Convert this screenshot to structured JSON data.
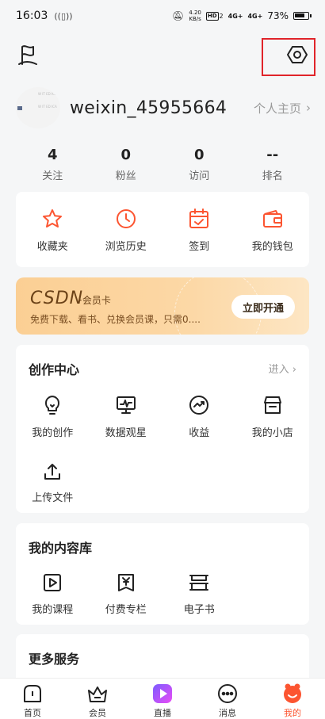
{
  "status": {
    "time": "16:03",
    "net_speed_top": "4.20",
    "net_speed_bottom": "KB/s",
    "hd": "HD",
    "hd2": "2",
    "sig1": "4G+",
    "sig2": "4G+",
    "battery": "73%"
  },
  "avatar": {
    "line1": "W IT ED ICA",
    "line2": "W IT ED ICA"
  },
  "profile": {
    "username": "weixin_45955664",
    "homepage_label": "个人主页"
  },
  "stats": [
    {
      "value": "4",
      "label": "关注"
    },
    {
      "value": "0",
      "label": "粉丝"
    },
    {
      "value": "0",
      "label": "访问"
    },
    {
      "value": "--",
      "label": "排名"
    }
  ],
  "quick": [
    {
      "label": "收藏夹",
      "icon": "star-icon"
    },
    {
      "label": "浏览历史",
      "icon": "clock-icon"
    },
    {
      "label": "签到",
      "icon": "calendar-check-icon"
    },
    {
      "label": "我的钱包",
      "icon": "wallet-icon"
    }
  ],
  "vip": {
    "brand": "CSDN",
    "sub": "·会员卡",
    "desc": "免费下载、看书、兑换会员课，只需0....",
    "button": "立即开通"
  },
  "creation": {
    "title": "创作中心",
    "more": "进入",
    "items": [
      {
        "label": "我的创作",
        "icon": "lightbulb-icon"
      },
      {
        "label": "数据观星",
        "icon": "monitor-chart-icon"
      },
      {
        "label": "收益",
        "icon": "income-icon"
      },
      {
        "label": "我的小店",
        "icon": "shop-icon"
      },
      {
        "label": "上传文件",
        "icon": "upload-icon"
      }
    ]
  },
  "library": {
    "title": "我的内容库",
    "items": [
      {
        "label": "我的课程",
        "icon": "play-course-icon"
      },
      {
        "label": "付费专栏",
        "icon": "paid-column-icon"
      },
      {
        "label": "电子书",
        "icon": "ebook-icon"
      }
    ]
  },
  "services": {
    "title": "更多服务"
  },
  "tabs": [
    {
      "label": "首页",
      "icon": "home-icon"
    },
    {
      "label": "会员",
      "icon": "vip-crown-icon"
    },
    {
      "label": "直播",
      "icon": "live-icon"
    },
    {
      "label": "消息",
      "icon": "message-icon"
    },
    {
      "label": "我的",
      "icon": "me-icon",
      "active": true
    }
  ],
  "colors": {
    "accent": "#fc5531",
    "highlight": "#e0242a",
    "vip_bg": "#fbcf94"
  }
}
